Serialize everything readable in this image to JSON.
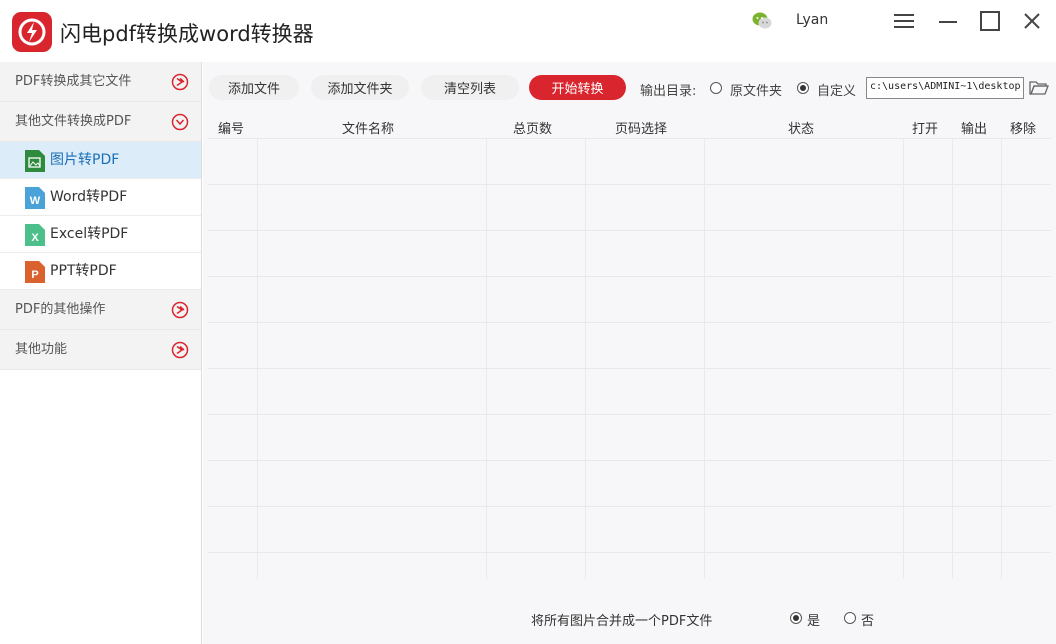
{
  "app": {
    "title": "闪电pdf转换成word转换器",
    "username": "Lyan"
  },
  "colors": {
    "brand_red": "#d9262e",
    "active_bg": "#dcecf9",
    "active_text": "#1a6fb5"
  },
  "sidebar": {
    "categories": [
      {
        "label": "PDF转换成其它文件",
        "icon": "arrow-right-circle-icon"
      },
      {
        "label": "其他文件转换成PDF",
        "icon": "arrow-down-circle-icon"
      },
      {
        "label": "PDF的其他操作",
        "icon": "arrow-right-circle-icon"
      },
      {
        "label": "其他功能",
        "icon": "arrow-right-circle-icon"
      }
    ],
    "items": [
      {
        "label": "图片转PDF",
        "icon": "image-file-icon",
        "active": true
      },
      {
        "label": "Word转PDF",
        "icon": "word-file-icon",
        "active": false
      },
      {
        "label": "Excel转PDF",
        "icon": "excel-file-icon",
        "active": false
      },
      {
        "label": "PPT转PDF",
        "icon": "ppt-file-icon",
        "active": false
      }
    ]
  },
  "toolbar": {
    "add_file": "添加文件",
    "add_folder": "添加文件夹",
    "clear_list": "清空列表",
    "start_convert": "开始转换",
    "output_label": "输出目录:",
    "opt_original": "原文件夹",
    "opt_custom": "自定义",
    "selected_output": "自定义",
    "path_value": "c:\\users\\ADMINI~1\\desktop"
  },
  "table": {
    "columns": [
      "编号",
      "文件名称",
      "总页数",
      "页码选择",
      "状态",
      "打开",
      "输出",
      "移除"
    ],
    "rows": []
  },
  "footer": {
    "merge_label": "将所有图片合并成一个PDF文件",
    "opt_yes": "是",
    "opt_no": "否",
    "selected": "是"
  }
}
